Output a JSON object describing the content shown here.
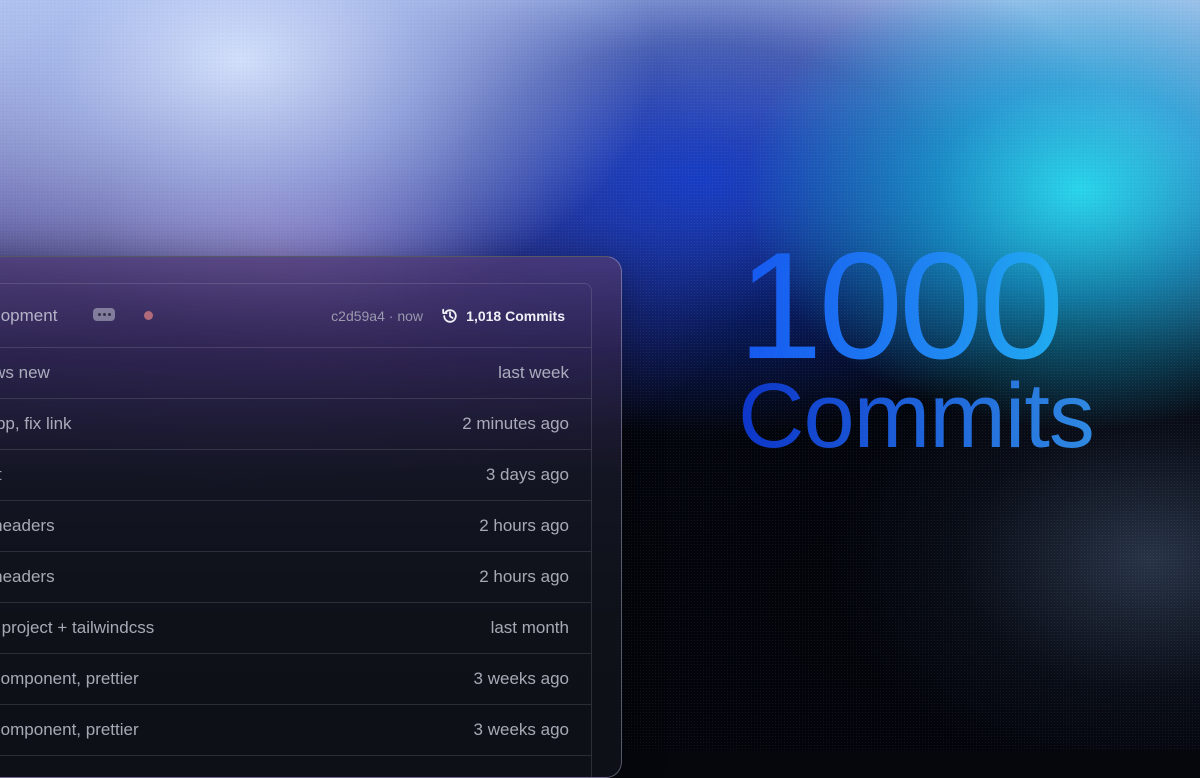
{
  "header": {
    "branch_label": "velopment",
    "sha_time": "c2d59a4 · now",
    "commits_count": "1,018 Commits"
  },
  "commits": [
    {
      "message": "rkflows new",
      "time": "last week"
    },
    {
      "message": "s webp, fix link",
      "time": "2 minutes ago"
    },
    {
      "message": " asset",
      "time": "3 days ago"
    },
    {
      "message": "nse headers",
      "time": "2 hours ago"
    },
    {
      "message": "nse headers",
      "time": "2 hours ago"
    },
    {
      "message": "t vite project + tailwindcss",
      "time": "last month"
    },
    {
      "message": "itch component, prettier",
      "time": "3 weeks ago"
    },
    {
      "message": "itch component, prettier",
      "time": "3 weeks ago"
    }
  ],
  "hero": {
    "number": "1000",
    "word": "Commits"
  },
  "icons": {
    "menu": "ellipsis-icon",
    "status": "status-dot-icon",
    "history": "history-icon"
  },
  "colors": {
    "status_dot": "#b06a7a",
    "hero_start": "#1657f0",
    "hero_end": "#22d6ee"
  }
}
